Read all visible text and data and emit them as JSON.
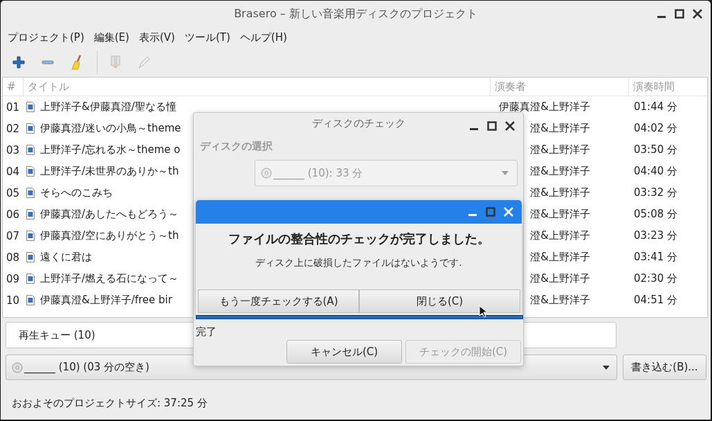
{
  "window": {
    "title": "Brasero – 新しい音楽用ディスクのプロジェクト"
  },
  "menu": [
    "プロジェクト(P)",
    "編集(E)",
    "表示(V)",
    "ツール(T)",
    "ヘルプ(H)"
  ],
  "toolbar": [
    {
      "kind": "add",
      "disabled": false
    },
    {
      "kind": "remove",
      "disabled": false
    },
    {
      "kind": "clear",
      "disabled": false
    },
    {
      "kind": "split",
      "disabled": true
    },
    {
      "kind": "edit",
      "disabled": true
    }
  ],
  "table": {
    "columns": [
      "#",
      "タイトル",
      "演奏者",
      "演奏時間"
    ],
    "rows": [
      {
        "number": "01",
        "title": "上野洋子&伊藤真澄/聖なる憧",
        "artist": "伊藤真澄&上野洋子",
        "duration": "01:44 分"
      },
      {
        "number": "02",
        "title": "伊藤真澄/迷いの小鳥～theme",
        "artist": "澄&上野洋子",
        "duration": "04:02 分"
      },
      {
        "number": "03",
        "title": "上野洋子/忘れる水～theme o",
        "artist": "澄&上野洋子",
        "duration": "03:50 分"
      },
      {
        "number": "04",
        "title": "上野洋子/未世界のありか～th",
        "artist": "澄&上野洋子",
        "duration": "04:40 分"
      },
      {
        "number": "05",
        "title": "そらへのこみち",
        "artist": "澄&上野洋子",
        "duration": "03:32 分"
      },
      {
        "number": "06",
        "title": "伊藤真澄/あしたへもどろう～",
        "artist": "澄&上野洋子",
        "duration": "05:08 分"
      },
      {
        "number": "07",
        "title": "伊藤真澄/空にありがとう～th",
        "artist": "澄&上野洋子",
        "duration": "03:23 分"
      },
      {
        "number": "08",
        "title": "遠くに君は",
        "artist": "澄&上野洋子",
        "duration": "03:41 分"
      },
      {
        "number": "09",
        "title": "上野洋子/燃える石になって～",
        "artist": "澄&上野洋子",
        "duration": "02:30 分"
      },
      {
        "number": "10",
        "title": "伊藤真澄&上野洋子/free bir",
        "artist": "澄&上野洋子",
        "duration": "04:51 分"
      }
    ]
  },
  "queue_field": {
    "value": "再生キュー (10)"
  },
  "disc_combo": {
    "value": "______ (10) (03 分の空き)"
  },
  "burn_button": {
    "label": "書き込む(B)..."
  },
  "status_bar": "おおよそのプロジェクトサイズ: 37:25 分",
  "check_dialog": {
    "title": "ディスクのチェック",
    "section": "ディスクの選択",
    "disc_combo": {
      "value": "______ (10): 33 分",
      "disabled": true
    },
    "progress": {
      "level": 1.0
    },
    "status": "完了",
    "buttons": [
      {
        "label": "キャンセル(C)",
        "disabled": false
      },
      {
        "label": "チェックの開始(C)",
        "disabled": true
      }
    ]
  },
  "result_dialog": {
    "headline": "ファイルの整合性のチェックが完了しました。",
    "message": "ディスク上に破損したファイルはないようです.",
    "buttons": [
      {
        "label": "もう一度チェックする(A)",
        "disabled": false
      },
      {
        "label": "閉じる(C)",
        "disabled": false
      }
    ]
  }
}
